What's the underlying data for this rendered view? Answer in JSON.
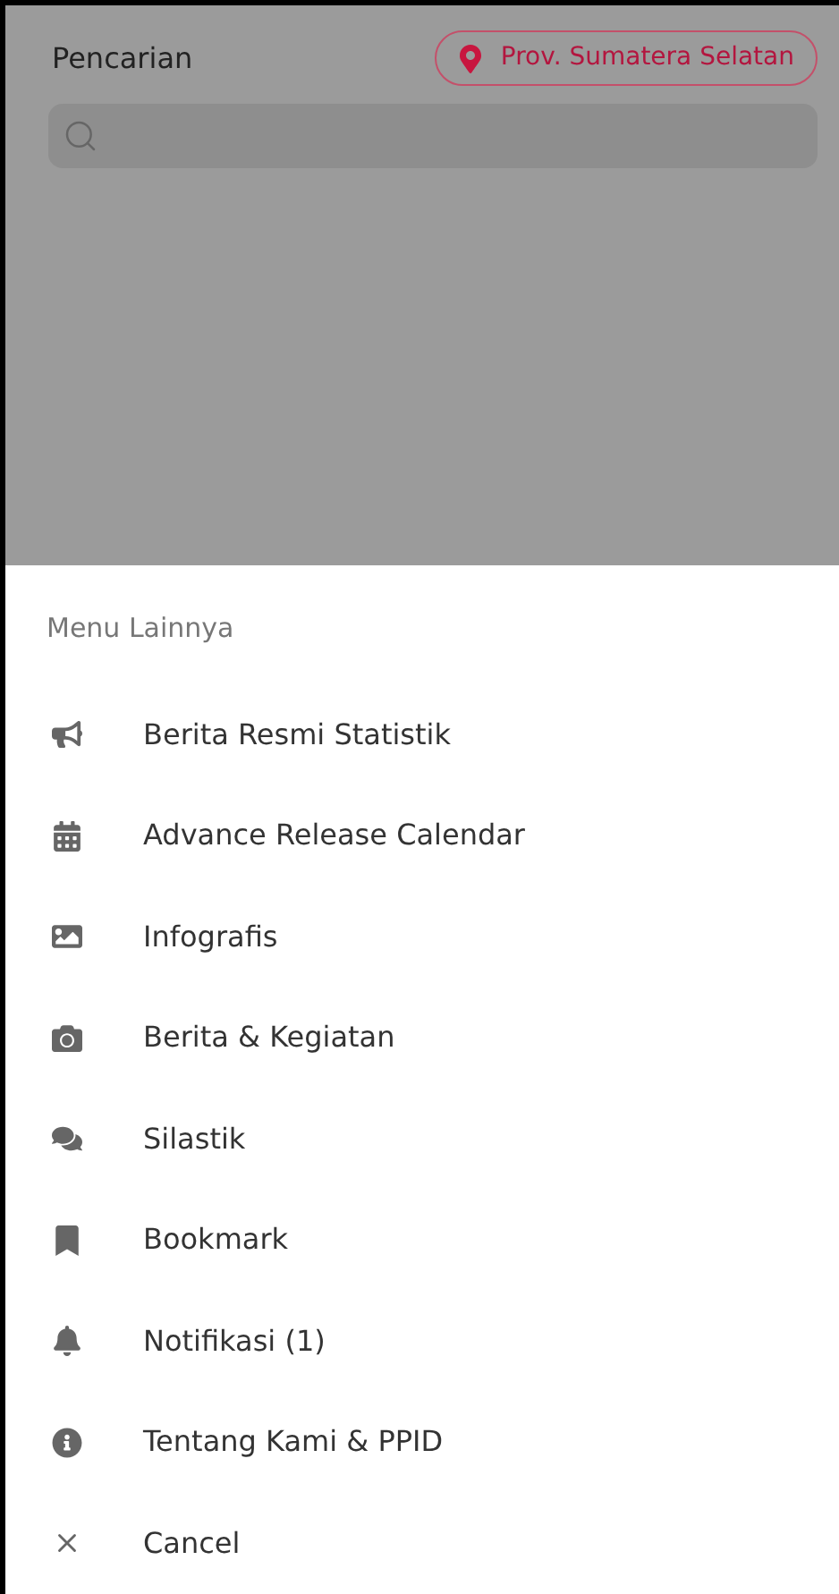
{
  "header": {
    "title": "Pencarian",
    "location": "Prov. Sumatera Selatan"
  },
  "menu": {
    "title": "Menu Lainnya",
    "items": [
      {
        "label": "Berita Resmi Statistik"
      },
      {
        "label": "Advance Release Calendar"
      },
      {
        "label": "Infografis"
      },
      {
        "label": "Berita & Kegiatan"
      },
      {
        "label": "Silastik"
      },
      {
        "label": "Bookmark"
      },
      {
        "label": "Notifikasi (1)"
      },
      {
        "label": "Tentang Kami & PPID"
      },
      {
        "label": "Cancel"
      }
    ]
  }
}
